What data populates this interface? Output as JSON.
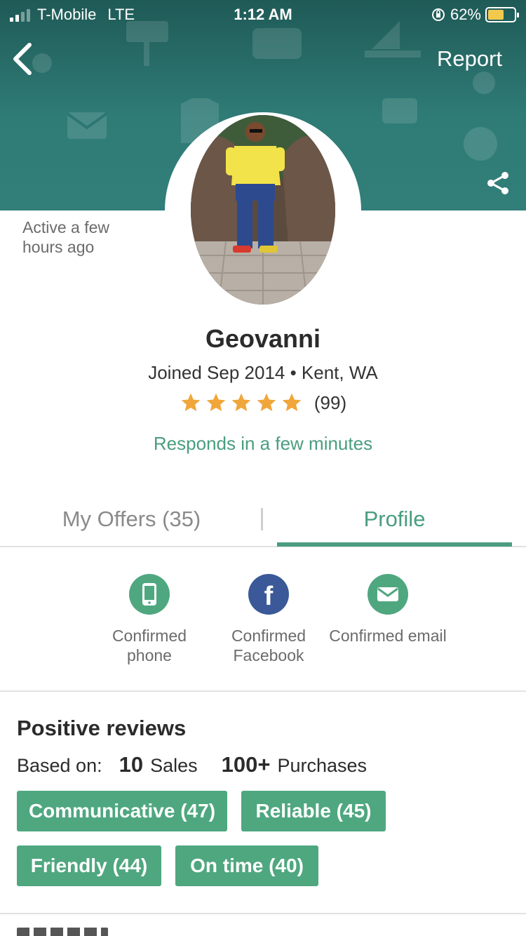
{
  "status_bar": {
    "carrier": "T-Mobile",
    "network": "LTE",
    "time": "1:12 AM",
    "battery_percent": "62%",
    "battery_level": 0.62
  },
  "header": {
    "back_icon": "chevron-left-icon",
    "report_label": "Report",
    "share_icon": "share-icon",
    "banner_color": "#2f7b76"
  },
  "profile": {
    "activity": "Active a few hours ago",
    "name": "Geovanni",
    "joined": "Joined Sep 2014 • Kent, WA",
    "rating_stars": 5,
    "rating_count": "(99)",
    "responds": "Responds in a few minutes",
    "accent_color": "#4a9d7f",
    "star_color": "#f0a63a"
  },
  "tabs": [
    {
      "label": "My Offers (35)",
      "active": false
    },
    {
      "label": "Profile",
      "active": true
    }
  ],
  "verifications": [
    {
      "icon": "phone-icon",
      "label": "Confirmed phone",
      "color": "#4fa77f"
    },
    {
      "icon": "facebook-icon",
      "label": "Confirmed Facebook",
      "color": "#3b5998"
    },
    {
      "icon": "email-icon",
      "label": "Confirmed email",
      "color": "#4fa77f"
    }
  ],
  "reviews": {
    "title": "Positive reviews",
    "based_on_label": "Based on:",
    "sales_count": "10",
    "sales_label": "Sales",
    "purchases_count": "100+",
    "purchases_label": "Purchases",
    "tags": [
      "Communicative (47)",
      "Reliable (45)",
      "Friendly (44)",
      "On time (40)"
    ]
  }
}
